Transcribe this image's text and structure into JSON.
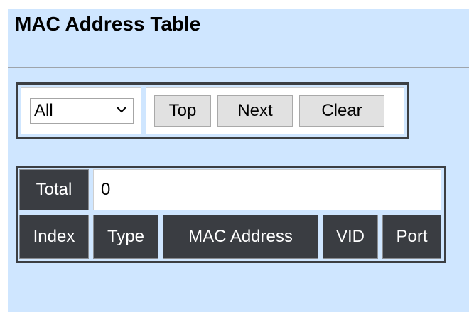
{
  "page": {
    "title": "MAC Address Table"
  },
  "controls": {
    "filter_select": {
      "selected": "All"
    },
    "buttons": {
      "top": "Top",
      "next": "Next",
      "clear": "Clear"
    }
  },
  "table": {
    "total_label": "Total",
    "total_value": "0",
    "columns": [
      "Index",
      "Type",
      "MAC Address",
      "VID",
      "Port"
    ]
  },
  "colors": {
    "background": "#cfe6ff",
    "header_dark": "#3a3d42",
    "header_text": "#ffffff"
  },
  "icons": {
    "dropdown": "chevron-down-icon"
  }
}
